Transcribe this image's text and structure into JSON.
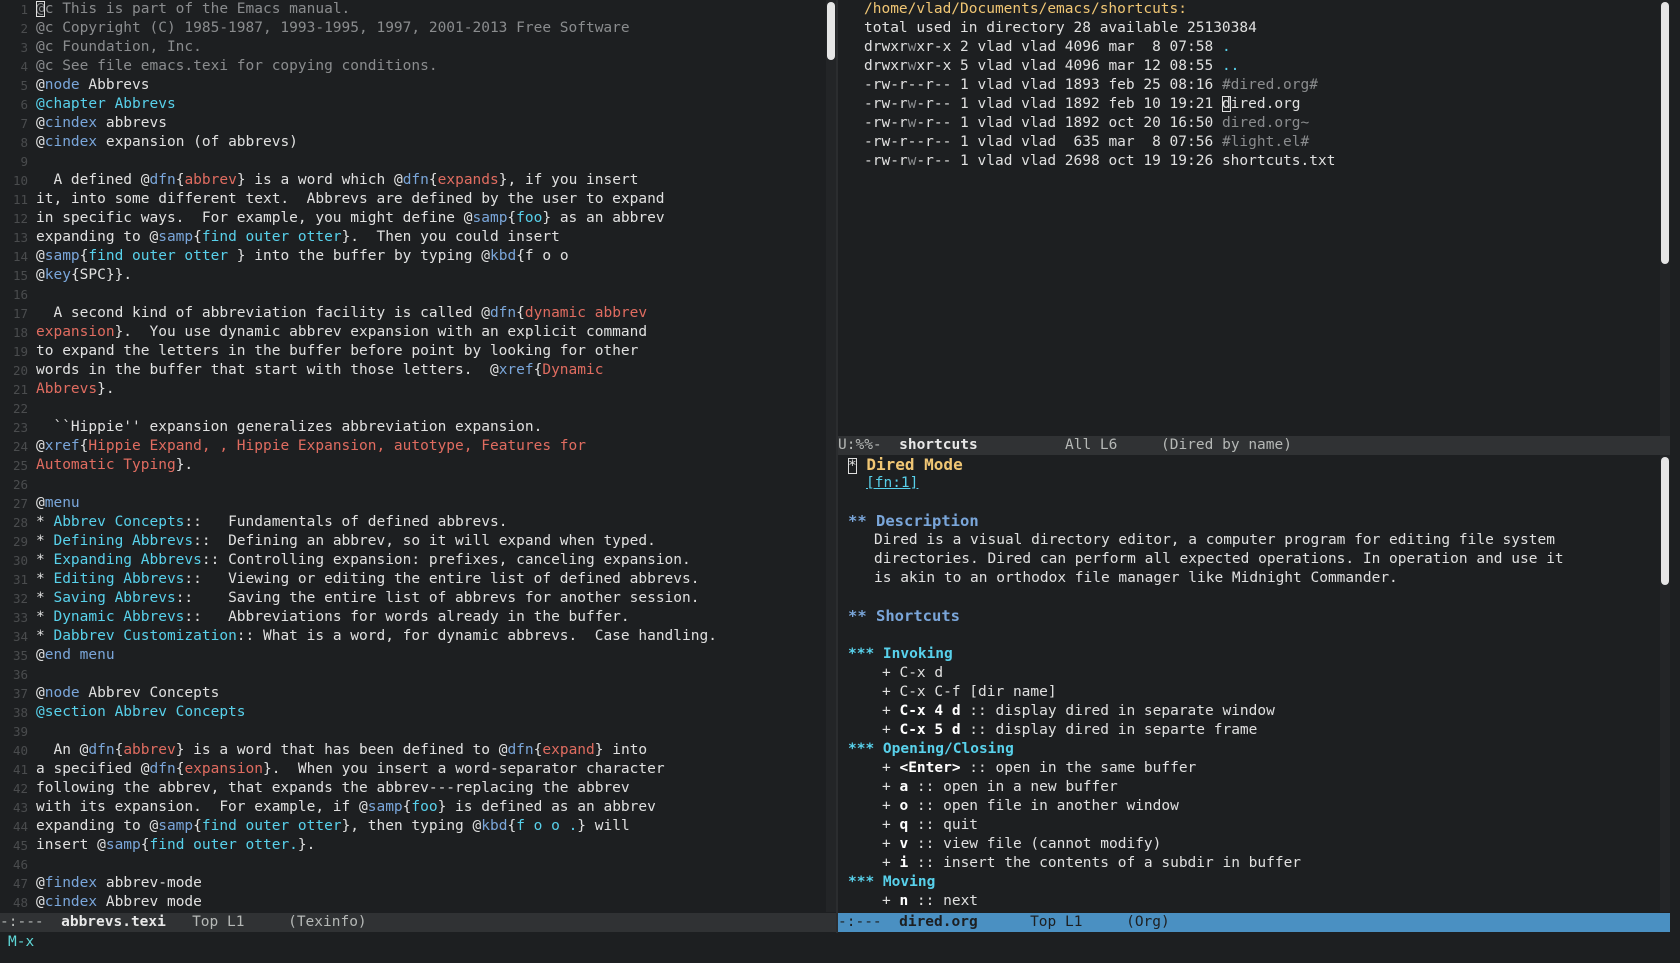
{
  "left_buffer": {
    "line_numbers": [
      "1",
      "2",
      "3",
      "4",
      "5",
      "6",
      "7",
      "8",
      "9",
      "10",
      "11",
      "12",
      "13",
      "14",
      "15",
      "16",
      "17",
      "18",
      "19",
      "20",
      "21",
      "22",
      "23",
      "24",
      "25",
      "26",
      "27",
      "28",
      "29",
      "30",
      "31",
      "32",
      "33",
      "34",
      "35",
      "36",
      "37",
      "38",
      "39",
      "40",
      "41",
      "42",
      "43",
      "44",
      "45",
      "46",
      "47",
      "48"
    ],
    "lines": [
      [
        {
          "t": "@c This is part of the Emacs manual.",
          "f": "comment"
        }
      ],
      [
        {
          "t": "@c Copyright (C) 1985-1987, 1993-1995, 1997, 2001-2013 Free Software",
          "f": "comment"
        }
      ],
      [
        {
          "t": "@c Foundation, Inc.",
          "f": "comment"
        }
      ],
      [
        {
          "t": "@c See file emacs.texi for copying conditions.",
          "f": "comment"
        }
      ],
      [
        {
          "t": "@",
          "f": "white"
        },
        {
          "t": "node",
          "f": "kw"
        },
        {
          "t": " Abbrevs",
          "f": "white"
        }
      ],
      [
        {
          "t": "@chapter Abbrevs",
          "f": "kw-cyan"
        }
      ],
      [
        {
          "t": "@",
          "f": "white"
        },
        {
          "t": "cindex",
          "f": "kw"
        },
        {
          "t": " abbrevs",
          "f": "white"
        }
      ],
      [
        {
          "t": "@",
          "f": "white"
        },
        {
          "t": "cindex",
          "f": "kw"
        },
        {
          "t": " expansion (of abbrevs)",
          "f": "white"
        }
      ],
      [],
      [
        {
          "t": "  A defined @",
          "f": "white"
        },
        {
          "t": "dfn",
          "f": "kw"
        },
        {
          "t": "{",
          "f": "white"
        },
        {
          "t": "abbrev",
          "f": "arg-red"
        },
        {
          "t": "} is a word which @",
          "f": "white"
        },
        {
          "t": "dfn",
          "f": "kw"
        },
        {
          "t": "{",
          "f": "white"
        },
        {
          "t": "expands",
          "f": "arg-red"
        },
        {
          "t": "}, if you insert",
          "f": "white"
        }
      ],
      [
        {
          "t": "it, into some different text.  Abbrevs are defined by the user to expand",
          "f": "white"
        }
      ],
      [
        {
          "t": "in specific ways.  For example, you might define @",
          "f": "white"
        },
        {
          "t": "samp",
          "f": "kw"
        },
        {
          "t": "{",
          "f": "white"
        },
        {
          "t": "foo",
          "f": "arg-cyan"
        },
        {
          "t": "} as an abbrev",
          "f": "white"
        }
      ],
      [
        {
          "t": "expanding to @",
          "f": "white"
        },
        {
          "t": "samp",
          "f": "kw"
        },
        {
          "t": "{",
          "f": "white"
        },
        {
          "t": "find outer otter",
          "f": "arg-cyan"
        },
        {
          "t": "}.  Then you could insert",
          "f": "white"
        }
      ],
      [
        {
          "t": "@",
          "f": "white"
        },
        {
          "t": "samp",
          "f": "kw"
        },
        {
          "t": "{",
          "f": "white"
        },
        {
          "t": "find outer otter",
          "f": "arg-cyan"
        },
        {
          "t": " } into the buffer by typing @",
          "f": "white"
        },
        {
          "t": "kbd",
          "f": "kw"
        },
        {
          "t": "{f o o",
          "f": "white"
        }
      ],
      [
        {
          "t": "@",
          "f": "white"
        },
        {
          "t": "key",
          "f": "kw"
        },
        {
          "t": "{SPC}}.",
          "f": "white"
        }
      ],
      [],
      [
        {
          "t": "  A second kind of abbreviation facility is called @",
          "f": "white"
        },
        {
          "t": "dfn",
          "f": "kw"
        },
        {
          "t": "{",
          "f": "white"
        },
        {
          "t": "dynamic abbrev",
          "f": "arg-red"
        }
      ],
      [
        {
          "t": "expansion",
          "f": "arg-red"
        },
        {
          "t": "}.  You use dynamic abbrev expansion with an explicit command",
          "f": "white"
        }
      ],
      [
        {
          "t": "to expand the letters in the buffer before point by looking for other",
          "f": "white"
        }
      ],
      [
        {
          "t": "words in the buffer that start with those letters.  @",
          "f": "white"
        },
        {
          "t": "xref",
          "f": "kw"
        },
        {
          "t": "{",
          "f": "white"
        },
        {
          "t": "Dynamic",
          "f": "arg-red"
        }
      ],
      [
        {
          "t": "Abbrevs",
          "f": "arg-red"
        },
        {
          "t": "}.",
          "f": "white"
        }
      ],
      [],
      [
        {
          "t": "  ``Hippie'' expansion generalizes abbreviation expansion.",
          "f": "white"
        }
      ],
      [
        {
          "t": "@",
          "f": "white"
        },
        {
          "t": "xref",
          "f": "kw"
        },
        {
          "t": "{",
          "f": "white"
        },
        {
          "t": "Hippie Expand, , Hippie Expansion, autotype, Features for",
          "f": "arg-red"
        }
      ],
      [
        {
          "t": "Automatic Typing",
          "f": "arg-red"
        },
        {
          "t": "}.",
          "f": "white"
        }
      ],
      [],
      [
        {
          "t": "@",
          "f": "white"
        },
        {
          "t": "menu",
          "f": "kw"
        }
      ],
      [
        {
          "t": "* ",
          "f": "white"
        },
        {
          "t": "Abbrev Concepts",
          "f": "arg-cyan"
        },
        {
          "t": "::   Fundamentals of defined abbrevs.",
          "f": "white"
        }
      ],
      [
        {
          "t": "* ",
          "f": "white"
        },
        {
          "t": "Defining Abbrevs",
          "f": "arg-cyan"
        },
        {
          "t": "::  Defining an abbrev, so it will expand when typed.",
          "f": "white"
        }
      ],
      [
        {
          "t": "* ",
          "f": "white"
        },
        {
          "t": "Expanding Abbrevs",
          "f": "arg-cyan"
        },
        {
          "t": ":: Controlling expansion: prefixes, canceling expansion.",
          "f": "white"
        }
      ],
      [
        {
          "t": "* ",
          "f": "white"
        },
        {
          "t": "Editing Abbrevs",
          "f": "arg-cyan"
        },
        {
          "t": "::   Viewing or editing the entire list of defined abbrevs.",
          "f": "white"
        }
      ],
      [
        {
          "t": "* ",
          "f": "white"
        },
        {
          "t": "Saving Abbrevs",
          "f": "arg-cyan"
        },
        {
          "t": "::    Saving the entire list of abbrevs for another session.",
          "f": "white"
        }
      ],
      [
        {
          "t": "* ",
          "f": "white"
        },
        {
          "t": "Dynamic Abbrevs",
          "f": "arg-cyan"
        },
        {
          "t": "::   Abbreviations for words already in the buffer.",
          "f": "white"
        }
      ],
      [
        {
          "t": "* ",
          "f": "white"
        },
        {
          "t": "Dabbrev Customization",
          "f": "arg-cyan"
        },
        {
          "t": ":: What is a word, for dynamic abbrevs.  Case handling.",
          "f": "white"
        }
      ],
      [
        {
          "t": "@",
          "f": "white"
        },
        {
          "t": "end menu",
          "f": "kw"
        }
      ],
      [],
      [
        {
          "t": "@",
          "f": "white"
        },
        {
          "t": "node",
          "f": "kw"
        },
        {
          "t": " Abbrev Concepts",
          "f": "white"
        }
      ],
      [
        {
          "t": "@section Abbrev Concepts",
          "f": "kw-cyan"
        }
      ],
      [],
      [
        {
          "t": "  An @",
          "f": "white"
        },
        {
          "t": "dfn",
          "f": "kw"
        },
        {
          "t": "{",
          "f": "white"
        },
        {
          "t": "abbrev",
          "f": "arg-red"
        },
        {
          "t": "} is a word that has been defined to @",
          "f": "white"
        },
        {
          "t": "dfn",
          "f": "kw"
        },
        {
          "t": "{",
          "f": "white"
        },
        {
          "t": "expand",
          "f": "arg-red"
        },
        {
          "t": "} into",
          "f": "white"
        }
      ],
      [
        {
          "t": "a specified @",
          "f": "white"
        },
        {
          "t": "dfn",
          "f": "kw"
        },
        {
          "t": "{",
          "f": "white"
        },
        {
          "t": "expansion",
          "f": "arg-red"
        },
        {
          "t": "}.  When you insert a word-separator character",
          "f": "white"
        }
      ],
      [
        {
          "t": "following the abbrev, that expands the abbrev---replacing the abbrev",
          "f": "white"
        }
      ],
      [
        {
          "t": "with its expansion.  For example, if @",
          "f": "white"
        },
        {
          "t": "samp",
          "f": "kw"
        },
        {
          "t": "{",
          "f": "white"
        },
        {
          "t": "foo",
          "f": "arg-cyan"
        },
        {
          "t": "} is defined as an abbrev",
          "f": "white"
        }
      ],
      [
        {
          "t": "expanding to @",
          "f": "white"
        },
        {
          "t": "samp",
          "f": "kw"
        },
        {
          "t": "{",
          "f": "white"
        },
        {
          "t": "find outer otter",
          "f": "arg-cyan"
        },
        {
          "t": "}, then typing @",
          "f": "white"
        },
        {
          "t": "kbd",
          "f": "kw"
        },
        {
          "t": "{",
          "f": "white"
        },
        {
          "t": "f o o .",
          "f": "arg-cyan"
        },
        {
          "t": "} will",
          "f": "white"
        }
      ],
      [
        {
          "t": "insert @",
          "f": "white"
        },
        {
          "t": "samp",
          "f": "kw"
        },
        {
          "t": "{",
          "f": "white"
        },
        {
          "t": "find outer otter.",
          "f": "arg-cyan"
        },
        {
          "t": "}.",
          "f": "white"
        }
      ],
      [],
      [
        {
          "t": "@",
          "f": "white"
        },
        {
          "t": "findex",
          "f": "kw"
        },
        {
          "t": " abbrev-mode",
          "f": "white"
        }
      ],
      [
        {
          "t": "@",
          "f": "white"
        },
        {
          "t": "cindex",
          "f": "kw"
        },
        {
          "t": " Abbrev mode",
          "f": "white"
        }
      ]
    ]
  },
  "left_modeline": {
    "status": "-:---  ",
    "buffer": "abbrevs.texi",
    "position": "   Top L1     ",
    "mode": "(Texinfo)"
  },
  "dired": {
    "path": "/home/vlad/Documents/emacs/shortcuts:",
    "total": "total used in directory 28 available 25130384",
    "entries": [
      {
        "perm_a": "drwxr",
        "perm_w": "w",
        "perm_b": "xr-x",
        "info": " 2 vlad vlad 4096 mar  8 07:58 ",
        "name": ".",
        "kind": "dir-name"
      },
      {
        "perm_a": "drwxr",
        "perm_w": "w",
        "perm_b": "xr-x",
        "info": " 5 vlad vlad 4096 mar 12 08:55 ",
        "name": "..",
        "kind": "dir-name"
      },
      {
        "perm_a": "-rw-r--r--",
        "perm_w": "",
        "perm_b": "",
        "info": " 1 vlad vlad 1893 feb 25 08:16 ",
        "name": "#dired.org#",
        "kind": "dim"
      },
      {
        "perm_a": "-rw-r",
        "perm_w": "w",
        "perm_b": "-r--",
        "info": " 1 vlad vlad 1892 feb 10 19:21 ",
        "name": "dired.org",
        "kind": "white"
      },
      {
        "perm_a": "-rw-r",
        "perm_w": "w",
        "perm_b": "-r--",
        "info": " 1 vlad vlad 1892 oct 20 16:50 ",
        "name": "dired.org~",
        "kind": "dim"
      },
      {
        "perm_a": "-rw-r--r--",
        "perm_w": "",
        "perm_b": "",
        "info": " 1 vlad vlad  635 mar  8 07:56 ",
        "name": "#light.el#",
        "kind": "dim"
      },
      {
        "perm_a": "-rw-r",
        "perm_w": "w",
        "perm_b": "-r--",
        "info": " 1 vlad vlad 2698 oct 19 19:26 ",
        "name": "shortcuts.txt",
        "kind": "white"
      }
    ]
  },
  "dired_modeline": {
    "status": "U:%%-  ",
    "buffer": "shortcuts",
    "position": "          All L6     ",
    "mode": "(Dired by name)"
  },
  "org": {
    "title_bullet": "*",
    "title": " Dired Mode",
    "footnote": "[fn:1]",
    "desc_heading": "** Description",
    "desc_lines": [
      "Dired is a visual directory editor, a computer program for editing file system",
      "directories. Dired can perform all expected operations. In operation and use it",
      "is akin to an orthodox file manager like Midnight Commander."
    ],
    "shortcuts_heading": "** Shortcuts",
    "invoking_heading": "*** Invoking",
    "invoking_items": [
      {
        "key": "C-x d",
        "desc": "",
        "bold": false
      },
      {
        "key": "C-x C-f [dir name]",
        "desc": "",
        "bold": false
      },
      {
        "key": "C-x 4 d",
        "desc": " :: display dired in separate window",
        "bold": true
      },
      {
        "key": "C-x 5 d",
        "desc": " :: display dired in separte frame",
        "bold": true
      }
    ],
    "opening_heading": "*** Opening/Closing",
    "opening_items": [
      {
        "key": "<Enter>",
        "desc": " :: open in the same buffer"
      },
      {
        "key": "a",
        "desc": " :: open in a new buffer"
      },
      {
        "key": "o",
        "desc": " :: open file in another window"
      },
      {
        "key": "q",
        "desc": " :: quit"
      },
      {
        "key": "v",
        "desc": " :: view file (cannot modify)"
      },
      {
        "key": "i",
        "desc": " :: insert the contents of a subdir in buffer"
      }
    ],
    "moving_heading": "*** Moving",
    "moving_items": [
      {
        "key": "n",
        "desc": " :: next"
      }
    ]
  },
  "org_modeline": {
    "status": "-:---  ",
    "buffer": "dired.org",
    "position": "      Top L1     ",
    "mode": "(Org)"
  },
  "minibuffer": "M-x",
  "colors": {
    "background": "#1d1f21",
    "keyword": "#7aa6da",
    "cyan": "#58d1eb",
    "red": "#e06c60",
    "yellow": "#f0c674",
    "active_modeline": "#4a90c2"
  }
}
